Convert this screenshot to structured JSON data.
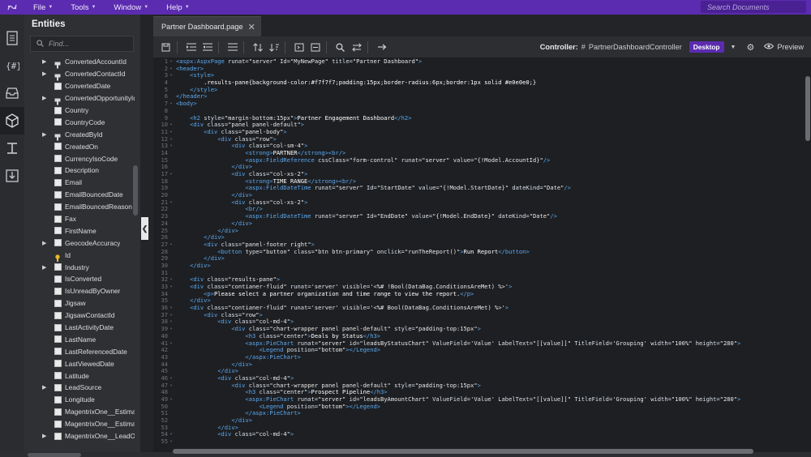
{
  "topbar": {
    "menu": [
      {
        "label": "File"
      },
      {
        "label": "Tools"
      },
      {
        "label": "Window"
      },
      {
        "label": "Help"
      }
    ],
    "search_placeholder": "Search Documents"
  },
  "entities": {
    "title": "Entities",
    "find_placeholder": "Find...",
    "items": [
      {
        "label": "ConvertedAccountId",
        "kind": "rel",
        "arrow": true
      },
      {
        "label": "ConvertedContactId",
        "kind": "rel",
        "arrow": true
      },
      {
        "label": "ConvertedDate",
        "kind": "field",
        "arrow": false
      },
      {
        "label": "ConvertedOpportunityId",
        "kind": "rel",
        "arrow": true
      },
      {
        "label": "Country",
        "kind": "field",
        "arrow": false
      },
      {
        "label": "CountryCode",
        "kind": "field",
        "arrow": false
      },
      {
        "label": "CreatedById",
        "kind": "rel",
        "arrow": true
      },
      {
        "label": "CreatedOn",
        "kind": "field",
        "arrow": false
      },
      {
        "label": "CurrencyIsoCode",
        "kind": "field",
        "arrow": false
      },
      {
        "label": "Description",
        "kind": "field",
        "arrow": false
      },
      {
        "label": "Email",
        "kind": "field",
        "arrow": false
      },
      {
        "label": "EmailBouncedDate",
        "kind": "field",
        "arrow": false
      },
      {
        "label": "EmailBouncedReason",
        "kind": "field",
        "arrow": false
      },
      {
        "label": "Fax",
        "kind": "field",
        "arrow": false
      },
      {
        "label": "FirstName",
        "kind": "field",
        "arrow": false
      },
      {
        "label": "GeocodeAccuracy",
        "kind": "field",
        "arrow": true
      },
      {
        "label": "Id",
        "kind": "key",
        "arrow": false
      },
      {
        "label": "Industry",
        "kind": "field",
        "arrow": true
      },
      {
        "label": "IsConverted",
        "kind": "field",
        "arrow": false
      },
      {
        "label": "IsUnreadByOwner",
        "kind": "field",
        "arrow": false
      },
      {
        "label": "Jigsaw",
        "kind": "field",
        "arrow": false
      },
      {
        "label": "JigsawContactId",
        "kind": "field",
        "arrow": false
      },
      {
        "label": "LastActivityDate",
        "kind": "field",
        "arrow": false
      },
      {
        "label": "LastName",
        "kind": "field",
        "arrow": false
      },
      {
        "label": "LastReferencedDate",
        "kind": "field",
        "arrow": false
      },
      {
        "label": "LastViewedDate",
        "kind": "field",
        "arrow": false
      },
      {
        "label": "Latitude",
        "kind": "field",
        "arrow": false
      },
      {
        "label": "LeadSource",
        "kind": "field",
        "arrow": true
      },
      {
        "label": "Longitude",
        "kind": "field",
        "arrow": false
      },
      {
        "label": "MagentrixOne__Estima",
        "kind": "field",
        "arrow": false
      },
      {
        "label": "MagentrixOne__Estima",
        "kind": "field",
        "arrow": false
      },
      {
        "label": "MagentrixOne__LeadO",
        "kind": "field",
        "arrow": true
      }
    ]
  },
  "editor": {
    "tab_label": "Partner Dashboard.page",
    "controller_label": "Controller:",
    "controller_hash": "#",
    "controller_name": "PartnerDashboardController",
    "device": "Desktop",
    "preview_label": "Preview"
  },
  "code": [
    {
      "n": "1",
      "f": "-",
      "html": "<span class='t'>&lt;aspx:AspxPage</span> <span class='a'>runat=</span><span class='s'>\"server\"</span> <span class='a'>Id=</span><span class='s'>\"MyNewPage\"</span> <span class='a'>title=</span><span class='s'>\"Partner Dashboard\"</span><span class='t'>&gt;</span>"
    },
    {
      "n": "2",
      "f": "-",
      "html": "<span class='t'>&lt;header&gt;</span>"
    },
    {
      "n": "3",
      "f": "-",
      "html": "    <span class='t'>&lt;style&gt;</span>"
    },
    {
      "n": "4",
      "f": "",
      "html": "        <span class='txt'>.results-pane{background-color:#f7f7f7;padding:15px;border-radius:6px;border:1px solid #e0e0e0;}</span>"
    },
    {
      "n": "5",
      "f": "",
      "html": "    <span class='t'>&lt;/style&gt;</span>"
    },
    {
      "n": "6",
      "f": "",
      "html": "<span class='t'>&lt;/header&gt;</span>"
    },
    {
      "n": "7",
      "f": "-",
      "html": "<span class='t'>&lt;body&gt;</span>"
    },
    {
      "n": "8",
      "f": "",
      "html": ""
    },
    {
      "n": "9",
      "f": "",
      "html": "    <span class='t'>&lt;h2</span> <span class='a'>style=</span><span class='s'>\"margin-bottom:15px\"</span><span class='t'>&gt;</span><span class='txt'>Partner Engagement Dashboard</span><span class='t'>&lt;/h2&gt;</span>"
    },
    {
      "n": "10",
      "f": "-",
      "html": "    <span class='t'>&lt;div</span> <span class='a'>class=</span><span class='s'>\"panel panel-default\"</span><span class='t'>&gt;</span>"
    },
    {
      "n": "11",
      "f": "-",
      "html": "        <span class='t'>&lt;div</span> <span class='a'>class=</span><span class='s'>\"panel-body\"</span><span class='t'>&gt;</span>"
    },
    {
      "n": "12",
      "f": "-",
      "html": "            <span class='t'>&lt;div</span> <span class='a'>class=</span><span class='s'>\"row\"</span><span class='t'>&gt;</span>"
    },
    {
      "n": "13",
      "f": "-",
      "html": "                <span class='t'>&lt;div</span> <span class='a'>class=</span><span class='s'>\"col-sm-4\"</span><span class='t'>&gt;</span>"
    },
    {
      "n": "14",
      "f": "",
      "html": "                    <span class='t'>&lt;strong&gt;</span><span class='txt'>PARTNER</span><span class='t'>&lt;/strong&gt;&lt;br/&gt;</span>"
    },
    {
      "n": "15",
      "f": "",
      "html": "                    <span class='t'>&lt;aspx:FieldReference</span> <span class='a'>cssClass=</span><span class='s'>\"form-control\"</span> <span class='a'>runat=</span><span class='s'>\"server\"</span> <span class='a'>value=</span><span class='s'>\"{!Model.AccountId}\"</span><span class='t'>/&gt;</span>"
    },
    {
      "n": "16",
      "f": "",
      "html": "                <span class='t'>&lt;/div&gt;</span>"
    },
    {
      "n": "17",
      "f": "-",
      "html": "                <span class='t'>&lt;div</span> <span class='a'>class=</span><span class='s'>\"col-xs-2\"</span><span class='t'>&gt;</span>"
    },
    {
      "n": "18",
      "f": "",
      "html": "                    <span class='t'>&lt;strong&gt;</span><span class='txt'>TIME RANGE</span><span class='t'>&lt;/strong&gt;&lt;br/&gt;</span>"
    },
    {
      "n": "19",
      "f": "",
      "html": "                    <span class='t'>&lt;aspx:FieldDateTime</span> <span class='a'>runat=</span><span class='s'>\"server\"</span> <span class='a'>Id=</span><span class='s'>\"StartDate\"</span> <span class='a'>value=</span><span class='s'>\"{!Model.StartDate}\"</span> <span class='a'>dateKind=</span><span class='s'>\"Date\"</span><span class='t'>/&gt;</span>"
    },
    {
      "n": "20",
      "f": "",
      "html": "                <span class='t'>&lt;/div&gt;</span>"
    },
    {
      "n": "21",
      "f": "-",
      "html": "                <span class='t'>&lt;div</span> <span class='a'>class=</span><span class='s'>\"col-xs-2\"</span><span class='t'>&gt;</span>"
    },
    {
      "n": "22",
      "f": "",
      "html": "                    <span class='t'>&lt;br/&gt;</span>"
    },
    {
      "n": "23",
      "f": "",
      "html": "                    <span class='t'>&lt;aspx:FieldDateTime</span> <span class='a'>runat=</span><span class='s'>\"server\"</span> <span class='a'>Id=</span><span class='s'>\"EndDate\"</span> <span class='a'>value=</span><span class='s'>\"{!Model.EndDate}\"</span> <span class='a'>dateKind=</span><span class='s'>\"Date\"</span><span class='t'>/&gt;</span>"
    },
    {
      "n": "24",
      "f": "",
      "html": "                <span class='t'>&lt;/div&gt;</span>"
    },
    {
      "n": "25",
      "f": "",
      "html": "            <span class='t'>&lt;/div&gt;</span>"
    },
    {
      "n": "26",
      "f": "",
      "html": "        <span class='t'>&lt;/div&gt;</span>"
    },
    {
      "n": "27",
      "f": "-",
      "html": "        <span class='t'>&lt;div</span> <span class='a'>class=</span><span class='s'>\"panel-footer right\"</span><span class='t'>&gt;</span>"
    },
    {
      "n": "28",
      "f": "",
      "html": "            <span class='t'>&lt;button</span> <span class='a'>type=</span><span class='s'>\"button\"</span> <span class='a'>class=</span><span class='s'>\"btn btn-primary\"</span> <span class='a'>onclick=</span><span class='s'>\"runTheReport()\"</span><span class='t'>&gt;</span><span class='txt'>Run Report</span><span class='t'>&lt;/button&gt;</span>"
    },
    {
      "n": "29",
      "f": "",
      "html": "        <span class='t'>&lt;/div&gt;</span>"
    },
    {
      "n": "30",
      "f": "",
      "html": "    <span class='t'>&lt;/div&gt;</span>"
    },
    {
      "n": "31",
      "f": "",
      "html": ""
    },
    {
      "n": "32",
      "f": "-",
      "html": "    <span class='t'>&lt;div</span> <span class='a'>class=</span><span class='s'>\"results-pane\"</span><span class='t'>&gt;</span>"
    },
    {
      "n": "33",
      "f": "-",
      "html": "    <span class='t'>&lt;div</span> <span class='a'>class=</span><span class='s'>\"contianer-fluid\"</span> <span class='a'>runat=</span><span class='s'>'server'</span> <span class='a'>visible=</span><span class='s'>'&lt;%# !Bool(DataBag.ConditionsAreMet) %&gt;'</span><span class='t'>&gt;</span>"
    },
    {
      "n": "34",
      "f": "",
      "html": "        <span class='t'>&lt;p&gt;</span><span class='txt'>Please select a partner organization and time range to view the report.</span><span class='t'>&lt;/p&gt;</span>"
    },
    {
      "n": "35",
      "f": "",
      "html": "    <span class='t'>&lt;/div&gt;</span>"
    },
    {
      "n": "36",
      "f": "-",
      "html": "    <span class='t'>&lt;div</span> <span class='a'>class=</span><span class='s'>\"contianer-fluid\"</span> <span class='a'>runat=</span><span class='s'>'server'</span> <span class='a'>visible=</span><span class='s'>'&lt;%# Bool(DataBag.ConditionsAreMet) %&gt;'</span><span class='t'>&gt;</span>"
    },
    {
      "n": "37",
      "f": "-",
      "html": "        <span class='t'>&lt;div</span> <span class='a'>class=</span><span class='s'>\"row\"</span><span class='t'>&gt;</span>"
    },
    {
      "n": "38",
      "f": "-",
      "html": "            <span class='t'>&lt;div</span> <span class='a'>class=</span><span class='s'>\"col-md-4\"</span><span class='t'>&gt;</span>"
    },
    {
      "n": "39",
      "f": "-",
      "html": "                <span class='t'>&lt;div</span> <span class='a'>class=</span><span class='s'>\"chart-wrapper panel panel-default\"</span> <span class='a'>style=</span><span class='s'>\"padding-top:15px\"</span><span class='t'>&gt;</span>"
    },
    {
      "n": "40",
      "f": "",
      "html": "                    <span class='t'>&lt;h3</span> <span class='a'>class=</span><span class='s'>\"center\"</span><span class='t'>&gt;</span><span class='txt'>Deals by Status</span><span class='t'>&lt;/h3&gt;</span>"
    },
    {
      "n": "41",
      "f": "-",
      "html": "                    <span class='t'>&lt;aspx:PieChart</span> <span class='a'>runat=</span><span class='s'>\"server\"</span> <span class='a'>id=</span><span class='s'>\"leadsByStatusChart\"</span> <span class='a'>ValueField=</span><span class='s'>'Value'</span> <span class='a'>LabelText=</span><span class='s'>\"[[value]]\"</span> <span class='a'>TitleField=</span><span class='s'>'Grouping'</span> <span class='a'>width=</span><span class='s'>\"100%\"</span> <span class='a'>height=</span><span class='s'>\"280\"</span><span class='t'>&gt;</span>"
    },
    {
      "n": "42",
      "f": "",
      "html": "                        <span class='t'>&lt;Legend</span> <span class='a'>position=</span><span class='s'>\"bottom\"</span><span class='t'>&gt;&lt;/Legend&gt;</span>"
    },
    {
      "n": "43",
      "f": "",
      "html": "                    <span class='t'>&lt;/aspx:PieChart&gt;</span>"
    },
    {
      "n": "44",
      "f": "",
      "html": "                <span class='t'>&lt;/div&gt;</span>"
    },
    {
      "n": "45",
      "f": "",
      "html": "            <span class='t'>&lt;/div&gt;</span>"
    },
    {
      "n": "46",
      "f": "-",
      "html": "            <span class='t'>&lt;div</span> <span class='a'>class=</span><span class='s'>\"col-md-4\"</span><span class='t'>&gt;</span>"
    },
    {
      "n": "47",
      "f": "-",
      "html": "                <span class='t'>&lt;div</span> <span class='a'>class=</span><span class='s'>\"chart-wrapper panel panel-default\"</span> <span class='a'>style=</span><span class='s'>\"padding-top:15px\"</span><span class='t'>&gt;</span>"
    },
    {
      "n": "48",
      "f": "",
      "html": "                    <span class='t'>&lt;h3</span> <span class='a'>class=</span><span class='s'>\"center\"</span><span class='t'>&gt;</span><span class='txt'>Prospect Pipeline</span><span class='t'>&lt;/h3&gt;</span>"
    },
    {
      "n": "49",
      "f": "-",
      "html": "                    <span class='t'>&lt;aspx:PieChart</span> <span class='a'>runat=</span><span class='s'>\"server\"</span> <span class='a'>id=</span><span class='s'>\"leadsByAmountChart\"</span> <span class='a'>ValueField=</span><span class='s'>'Value'</span> <span class='a'>LabelText=</span><span class='s'>\"[[value]]\"</span> <span class='a'>TitleField=</span><span class='s'>'Grouping'</span> <span class='a'>width=</span><span class='s'>\"100%\"</span> <span class='a'>height=</span><span class='s'>\"280\"</span><span class='t'>&gt;</span>"
    },
    {
      "n": "50",
      "f": "",
      "html": "                        <span class='t'>&lt;Legend</span> <span class='a'>position=</span><span class='s'>\"bottom\"</span><span class='t'>&gt;&lt;/Legend&gt;</span>"
    },
    {
      "n": "51",
      "f": "",
      "html": "                    <span class='t'>&lt;/aspx:PieChart&gt;</span>"
    },
    {
      "n": "52",
      "f": "",
      "html": "                <span class='t'>&lt;/div&gt;</span>"
    },
    {
      "n": "53",
      "f": "",
      "html": "            <span class='t'>&lt;/div&gt;</span>"
    },
    {
      "n": "54",
      "f": "-",
      "html": "            <span class='t'>&lt;div</span> <span class='a'>class=</span><span class='s'>\"col-md-4\"</span><span class='t'>&gt;</span>"
    },
    {
      "n": "55",
      "f": "-",
      "html": ""
    }
  ]
}
